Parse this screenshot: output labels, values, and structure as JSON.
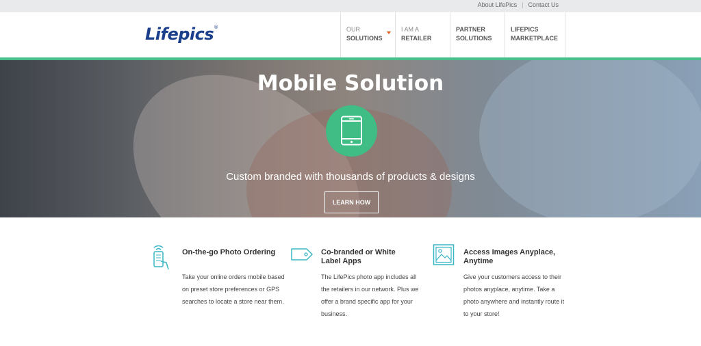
{
  "topbar": {
    "about": "About LifePics",
    "contact": "Contact Us"
  },
  "header": {
    "logo": "Lifepics",
    "nav": [
      {
        "line1": "OUR",
        "line2": "SOLUTIONS"
      },
      {
        "line1": "I AM A",
        "line2": "RETAILER"
      },
      {
        "line1": "PARTNER",
        "line2": "SOLUTIONS"
      },
      {
        "line1": "LIFEPICS",
        "line2": "MARKETPLACE"
      }
    ]
  },
  "hero": {
    "title": "Mobile Solution",
    "subtitle": "Custom branded with thousands of products & designs",
    "button": "LEARN HOW"
  },
  "features": [
    {
      "icon": "phone-order-icon",
      "title": "On-the-go Photo Ordering",
      "text": "Take your online orders mobile based on preset store preferences or GPS searches to locate a store near them."
    },
    {
      "icon": "tag-icon",
      "title": "Co-branded or White Label Apps",
      "text": "The LifePics photo app includes all the retailers in our network. Plus we offer a brand specific app for your business."
    },
    {
      "icon": "image-icon",
      "title": "Access Images Anyplace, Anytime",
      "text": "Give your customers access to their photos anyplace, anytime. Take a photo anywhere and instantly route it to your store!"
    }
  ],
  "colors": {
    "brand_blue": "#1b3f8b",
    "accent_green": "#48c08b",
    "icon_teal": "#3bb6c4",
    "caret_orange": "#e0591f"
  }
}
